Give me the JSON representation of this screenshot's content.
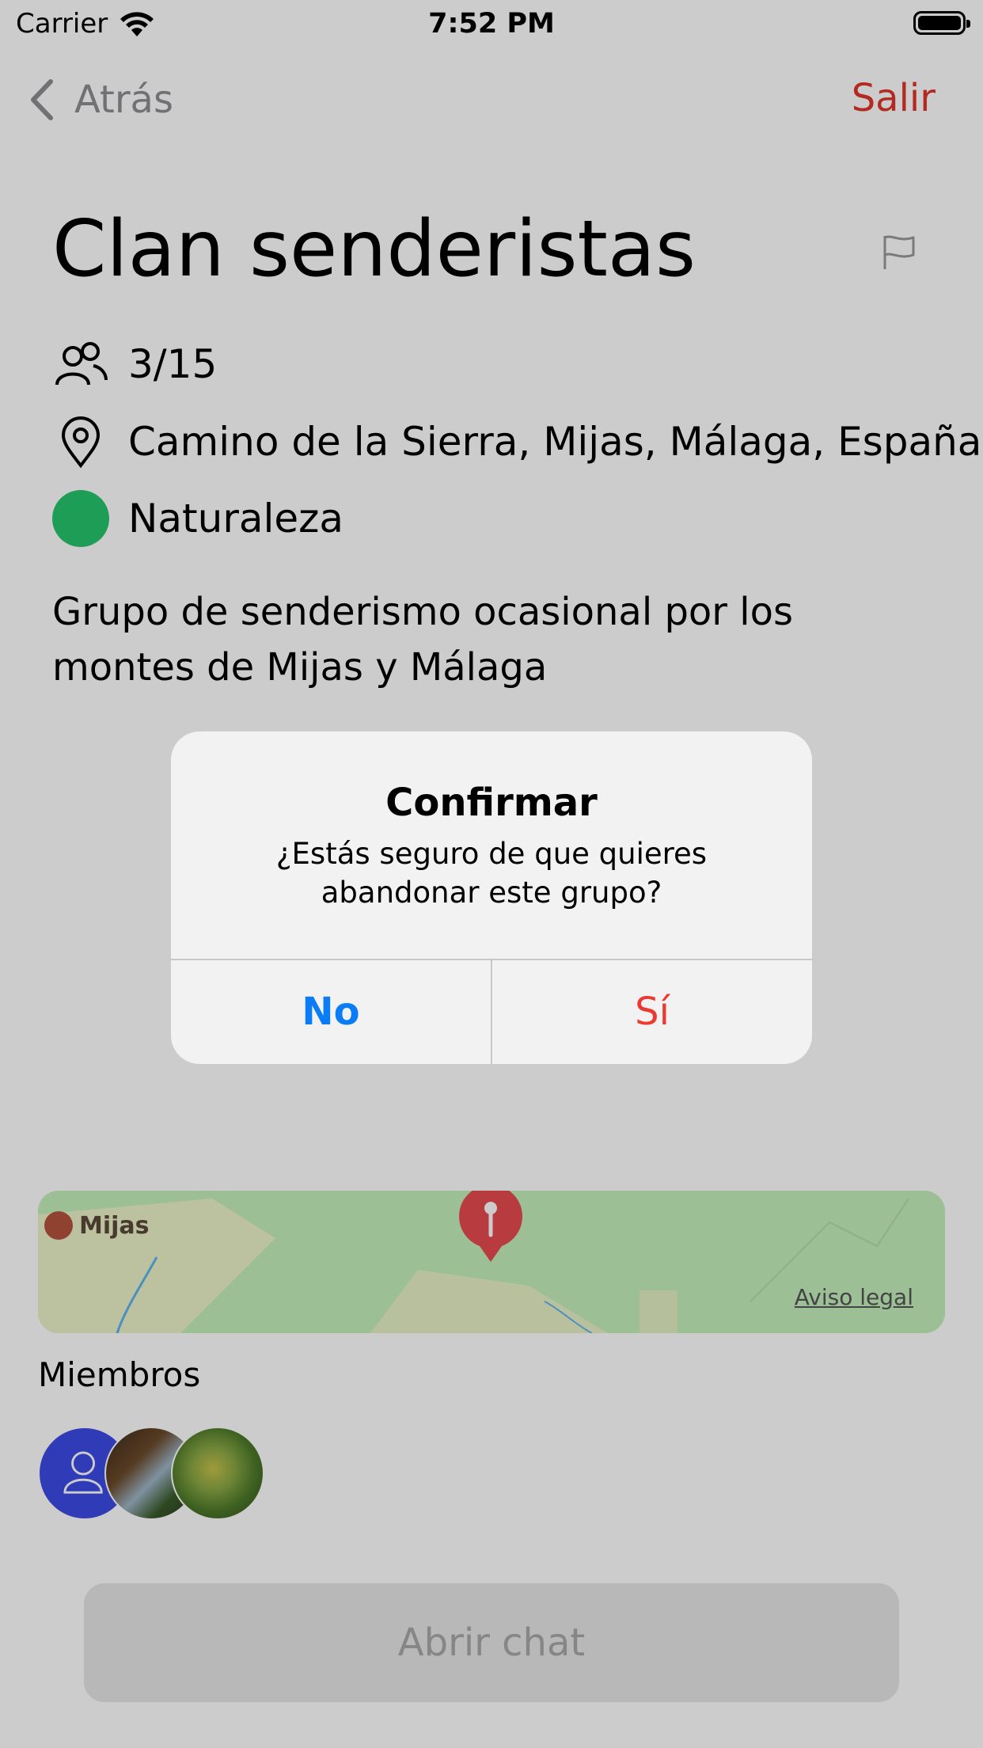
{
  "status_bar": {
    "carrier": "Carrier",
    "time": "7:52 PM"
  },
  "nav": {
    "back_label": "Atrás",
    "exit_label": "Salir"
  },
  "group": {
    "title": "Clan senderistas",
    "members_count": "3/15",
    "location": "Camino de la Sierra, Mijas, Málaga, España",
    "category": "Naturaleza",
    "category_color": "#26c56d",
    "description": "Grupo de senderismo ocasional por los montes de Mijas y Málaga"
  },
  "map": {
    "place_label": "Mijas",
    "legal_link": "Aviso legal"
  },
  "members": {
    "title": "Miembros"
  },
  "chat_button": {
    "label": "Abrir chat"
  },
  "alert": {
    "title": "Confirmar",
    "message": "¿Estás seguro de que quieres abandonar este grupo?",
    "no_label": "No",
    "yes_label": "Sí"
  },
  "colors": {
    "accent_red": "#e0352b",
    "link_blue": "#0a7cf5"
  }
}
